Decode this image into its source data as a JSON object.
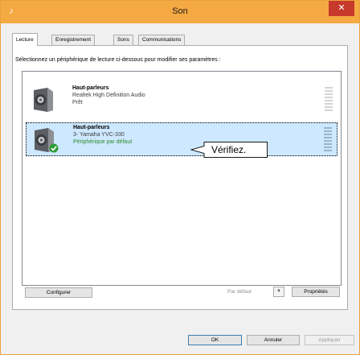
{
  "window": {
    "title": "Son",
    "close_glyph": "✕",
    "app_icon": "speaker-icon"
  },
  "tabs": [
    {
      "label": "Lecture"
    },
    {
      "label": "Enregistrement"
    },
    {
      "label": "Sons"
    },
    {
      "label": "Communications"
    }
  ],
  "instruction": "Sélectionnez un périphérique de lecture ci-dessous pour modifier ses paramètres :",
  "devices": [
    {
      "name": "Haut-parleurs",
      "line1": "Realtek High Definition Audio",
      "line2": "Prêt"
    },
    {
      "name": "Haut-parleurs",
      "line1": "3- Yamaha YVC-330",
      "line2": "Périphérique par défaut"
    }
  ],
  "annotation": {
    "label": "Vérifiez."
  },
  "buttons": {
    "configure": "Configurer",
    "default": "Par défaut",
    "properties": "Propriétés",
    "ok": "OK",
    "cancel": "Annuler",
    "apply": "Appliquer"
  },
  "colors": {
    "titlebar": "#f5a942",
    "close": "#c7392b",
    "selection": "#cde8ff"
  }
}
